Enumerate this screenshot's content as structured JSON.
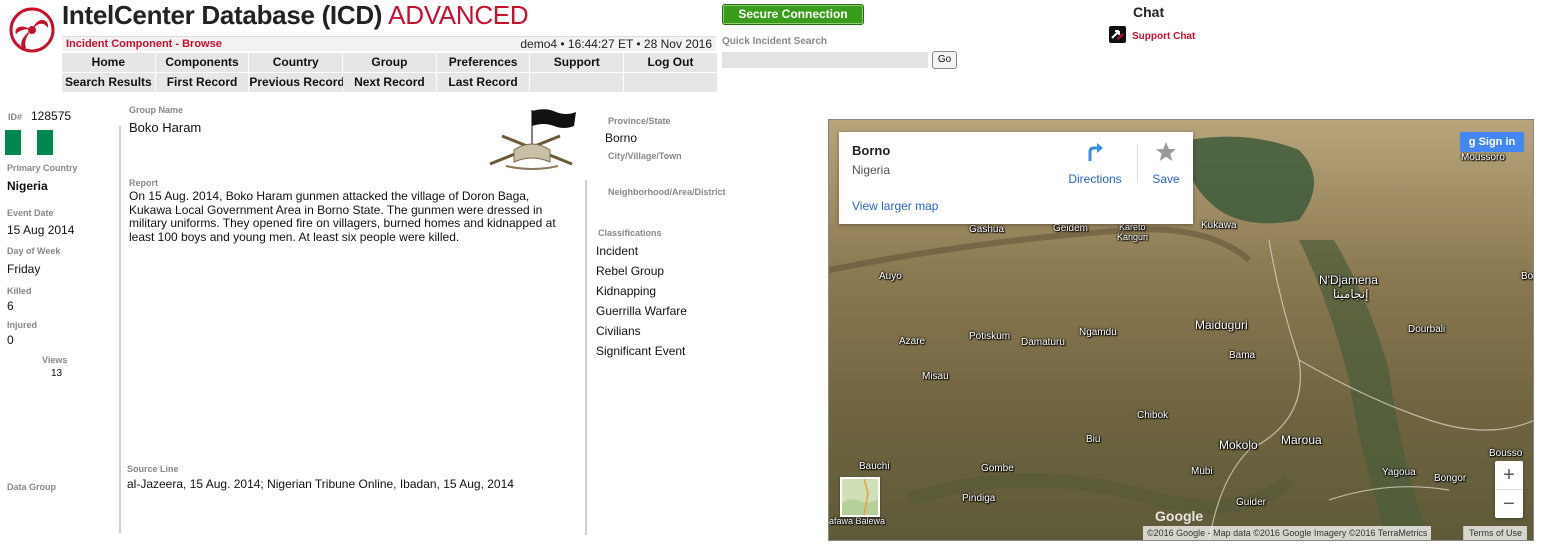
{
  "header": {
    "title": "IntelCenter Database (ICD)",
    "edition": "ADVANCED",
    "breadcrumb": "Incident Component - Browse",
    "session_info": "demo4 • 16:44:27 ET • 28 Nov 2016",
    "secure_label": "Secure Connection",
    "quick_search_label": "Quick Incident Search",
    "quick_search_value": "",
    "go_label": "Go",
    "chat_title": "Chat",
    "support_chat_label": "Support Chat"
  },
  "nav": {
    "row1": [
      "Home",
      "Components",
      "Country",
      "Group",
      "Preferences",
      "Support",
      "Log Out"
    ],
    "row2": [
      "Search Results",
      "First Record",
      "Previous Record",
      "Next Record",
      "Last Record",
      "",
      ""
    ]
  },
  "record": {
    "id_label": "ID#",
    "id": "128575",
    "primary_country_label": "Primary Country",
    "primary_country": "Nigeria",
    "event_date_label": "Event Date",
    "event_date": "15 Aug 2014",
    "day_of_week_label": "Day of Week",
    "day_of_week": "Friday",
    "killed_label": "Killed",
    "killed": "6",
    "injured_label": "Injured",
    "injured": "0",
    "views_label": "Views",
    "views": "13",
    "data_group_label": "Data Group",
    "group_name_label": "Group Name",
    "group_name": "Boko Haram",
    "report_label": "Report",
    "report": "On 15 Aug. 2014, Boko Haram gunmen attacked the village of Doron Baga, Kukawa Local Government Area in Borno State. The gunmen were dressed in military uniforms. They opened fire on villagers, burned homes and kidnapped at least 100 boys and young men. At least six people were killed.",
    "source_line_label": "Source Line",
    "source_line": "al-Jazeera, 15 Aug. 2014; Nigerian Tribune Online, Ibadan, 15 Aug, 2014",
    "province_label": "Province/State",
    "province": "Borno",
    "city_label": "City/Village/Town",
    "neighborhood_label": "Neighborhood/Area/District",
    "classifications_label": "Classifications",
    "classifications": [
      "Incident",
      "Rebel Group",
      "Kidnapping",
      "Guerrilla Warfare",
      "Civilians",
      "Significant Event"
    ],
    "flag_colors": [
      "#008751",
      "#ffffff",
      "#008751"
    ]
  },
  "map": {
    "info_title": "Borno",
    "info_subtitle": "Nigeria",
    "directions_label": "Directions",
    "save_label": "Save",
    "larger_map_label": "View larger map",
    "signin_label": "Sign in",
    "zoom_in": "+",
    "zoom_out": "−",
    "google_logo": "Google",
    "attribution": "©2016 Google - Map data ©2016 Google Imagery ©2016 TerraMetrics",
    "terms_label": "Terms of Use",
    "places": {
      "moussoro": "Moussoro",
      "gashua": "Gashua",
      "geidem": "Geidem",
      "kareto": "Kareto",
      "kanguri": "Kanguri",
      "kukawa": "Kukawa",
      "auyo": "Auyo",
      "ndjamena": "N'Djamena",
      "ndjamena_ar": "إنجامينا",
      "bo": "Bo",
      "azare": "Azare",
      "potiskum": "Potiskum",
      "damaturu": "Damaturu",
      "ngamdu": "Ngamdu",
      "maiduguri": "Maiduguri",
      "dourbali": "Dourbali",
      "bama": "Bama",
      "misau": "Misau",
      "chibok": "Chibok",
      "biu": "Biu",
      "mokolo": "Mokolo",
      "maroua": "Maroua",
      "bousso": "Bousso",
      "bauchi": "Bauchi",
      "gombe": "Gombe",
      "mubi": "Mubi",
      "yagoua": "Yagoua",
      "bongor": "Bongor",
      "pindiga": "Pindiga",
      "guider": "Guider",
      "kafawa_balewa": "afawa Balewa"
    }
  },
  "colors": {
    "brand_red": "#c8102e",
    "secure_green": "#3a9c1d",
    "nav_gray": "#e6e6e6",
    "link_blue": "#2a64c0"
  }
}
